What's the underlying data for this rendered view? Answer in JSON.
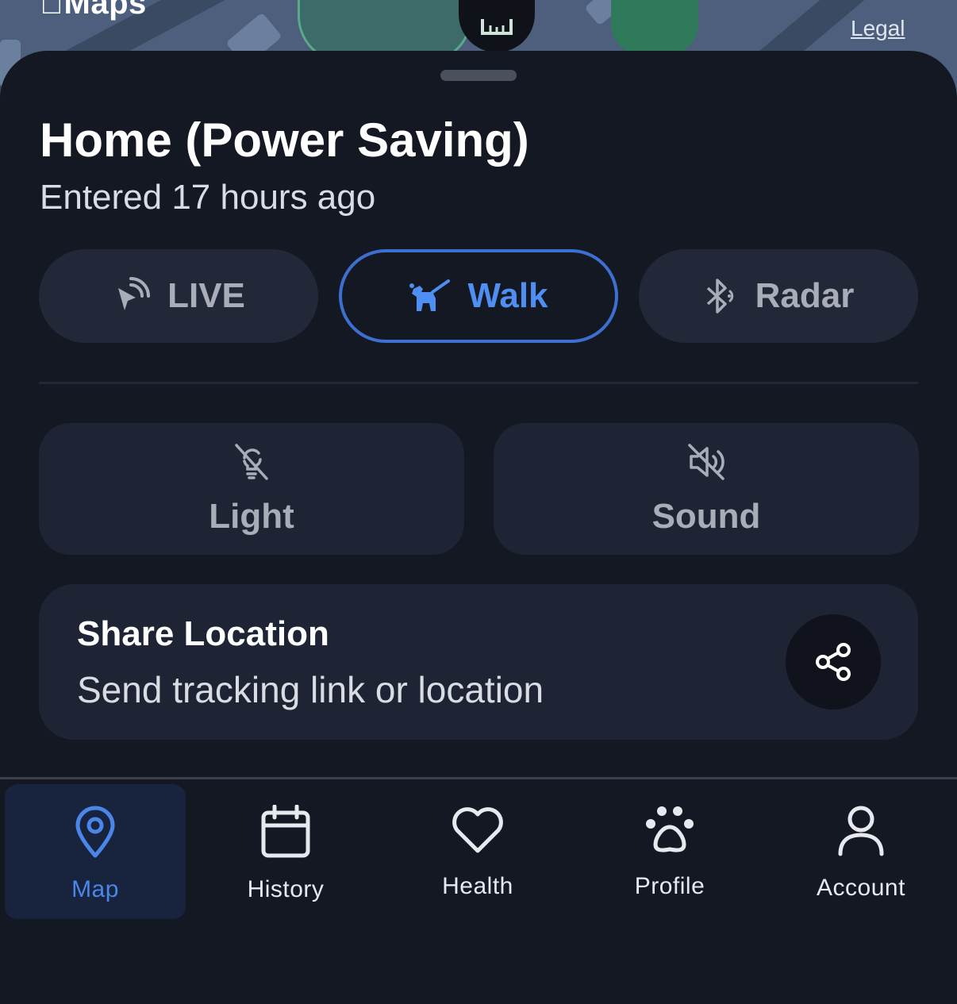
{
  "map": {
    "logo_text": "Maps",
    "legal_label": "Legal"
  },
  "place": {
    "title": "Home (Power Saving)",
    "subtitle": "Entered 17 hours ago"
  },
  "modes": {
    "live_label": "LIVE",
    "walk_label": "Walk",
    "radar_label": "Radar",
    "selected": "Walk",
    "accent_color": "#3d6fd1"
  },
  "controls": {
    "light_label": "Light",
    "sound_label": "Sound"
  },
  "share": {
    "title": "Share Location",
    "subtitle": "Send tracking link or location"
  },
  "tabs": {
    "items": [
      {
        "label": "Map",
        "icon": "map-pin-icon"
      },
      {
        "label": "History",
        "icon": "calendar-icon"
      },
      {
        "label": "Health",
        "icon": "heart-icon"
      },
      {
        "label": "Profile",
        "icon": "paw-icon"
      },
      {
        "label": "Account",
        "icon": "user-icon"
      }
    ],
    "active": "Map",
    "active_color": "#4a86ea"
  }
}
